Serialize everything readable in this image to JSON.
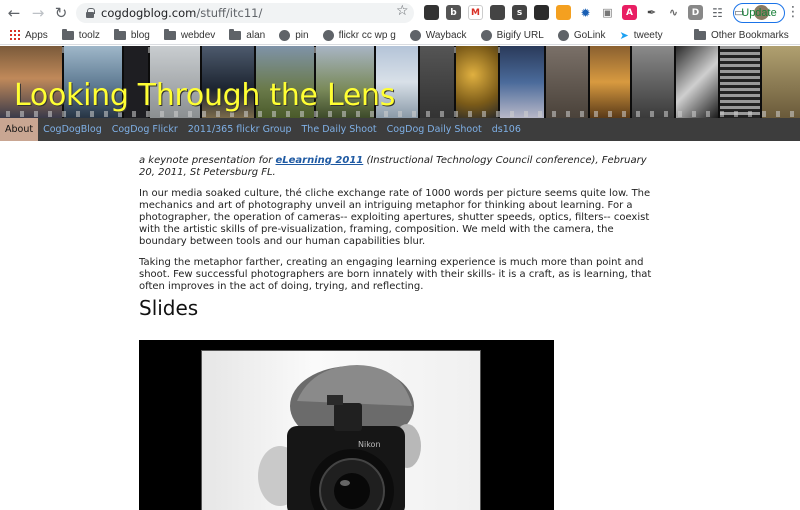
{
  "browser": {
    "url_host": "cogdogblog.com",
    "url_path": "/stuff/itc11/",
    "update_label": "Update",
    "bookmarks": [
      {
        "label": "Apps",
        "icon": "apps-grid-icon"
      },
      {
        "label": "toolz",
        "icon": "folder-icon"
      },
      {
        "label": "blog",
        "icon": "folder-icon"
      },
      {
        "label": "webdev",
        "icon": "folder-icon"
      },
      {
        "label": "alan",
        "icon": "folder-icon"
      },
      {
        "label": "pin",
        "icon": "globe-icon"
      },
      {
        "label": "flickr cc wp g",
        "icon": "globe-icon"
      },
      {
        "label": "Wayback",
        "icon": "globe-icon"
      },
      {
        "label": "Bigify URL",
        "icon": "globe-icon"
      },
      {
        "label": "GoLink",
        "icon": "globe-icon"
      },
      {
        "label": "tweety",
        "icon": "bird-icon"
      }
    ],
    "other_bookmarks": "Other Bookmarks"
  },
  "site": {
    "title": "Looking Through the Lens",
    "title_color": "#ffff33",
    "nav": [
      "About",
      "CogDogBlog",
      "CogDog Flickr",
      "2011/365 flickr Group",
      "The Daily Shoot",
      "CogDog Daily Shoot",
      "ds106"
    ],
    "nav_active": "About"
  },
  "content": {
    "intro_prefix": "a keynote presentation for ",
    "intro_link": "eLearning 2011",
    "intro_suffix": " (Instructional Technology Council conference), February 20, 2011, St Petersburg FL.",
    "para1": "In our media soaked culture, thé cliche exchange rate of 1000 words per picture seems quite low. The mechanics and art of photography unveil an intriguing metaphor for thinking about learning. For a photographer, the operation of cameras-- exploiting apertures, shutter speeds, optics, filters-- coexist with the artistic skills of pre-visualization, framing, composition. We meld with the camera, the boundary between tools and our human capabilities blur.",
    "para2": "Taking the metaphor farther, creating an engaging learning experience is much more than point and shoot. Few successful photographers are born innately with their skills- it is a craft, as is learning, that often improves in the act of doing, trying, and reflecting.",
    "slides_heading": "Slides",
    "camera_brand": "Nikon"
  }
}
